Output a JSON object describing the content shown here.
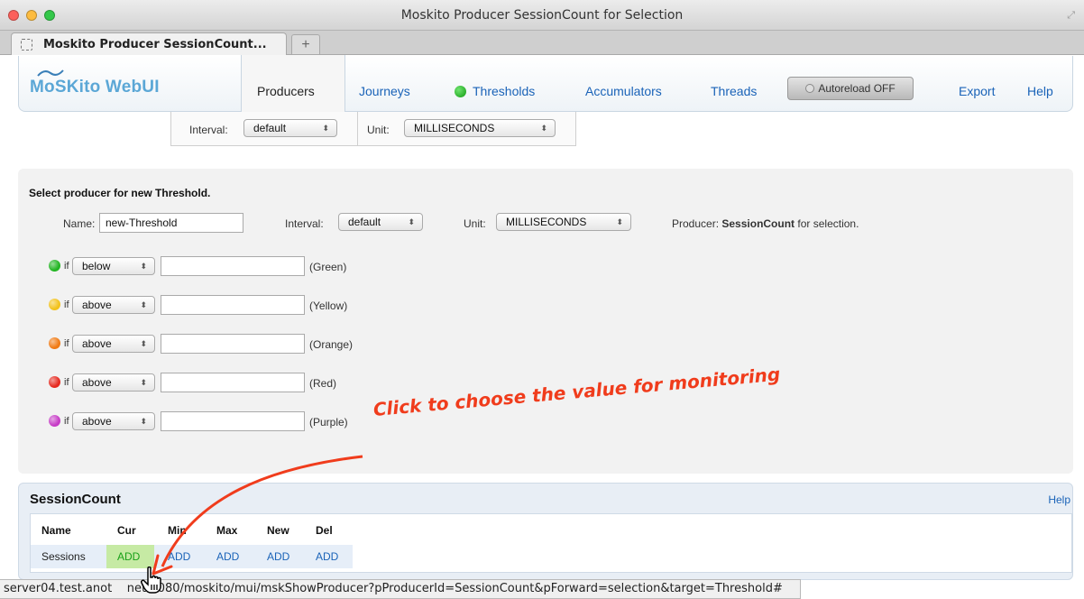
{
  "window": {
    "title": "Moskito Producer SessionCount for Selection",
    "tab_title": "Moskito Producer SessionCount...",
    "new_tab_label": "+"
  },
  "nav": {
    "logo": "MoSKito WebUI",
    "items": [
      "Producers",
      "Journeys",
      "Thresholds",
      "Accumulators",
      "Threads"
    ],
    "autoreload": "Autoreload OFF",
    "export": "Export",
    "help": "Help"
  },
  "filter": {
    "interval_label": "Interval:",
    "interval_value": "default",
    "unit_label": "Unit:",
    "unit_value": "MILLISECONDS"
  },
  "threshold_form": {
    "title": "Select producer for new Threshold.",
    "name_label": "Name:",
    "name_value": "new-Threshold",
    "interval_label": "Interval:",
    "interval_value": "default",
    "unit_label": "Unit:",
    "unit_value": "MILLISECONDS",
    "producer_label": "Producer:",
    "producer_name": "SessionCount",
    "producer_suffix": "for selection.",
    "if_label": "if",
    "rows": [
      {
        "condition": "below",
        "value": "",
        "label": "(Green)",
        "color": "#22b522"
      },
      {
        "condition": "above",
        "value": "",
        "label": "(Yellow)",
        "color": "#f2c21b"
      },
      {
        "condition": "above",
        "value": "",
        "label": "(Orange)",
        "color": "#f07a14"
      },
      {
        "condition": "above",
        "value": "",
        "label": "(Red)",
        "color": "#e62a20"
      },
      {
        "condition": "above",
        "value": "",
        "label": "(Purple)",
        "color": "#c63cc6"
      }
    ]
  },
  "session_count": {
    "title": "SessionCount",
    "help": "Help",
    "columns": [
      "Name",
      "Cur",
      "Min",
      "Max",
      "New",
      "Del"
    ],
    "row": [
      "Sessions",
      "ADD",
      "ADD",
      "ADD",
      "ADD",
      "ADD"
    ]
  },
  "annotation": "Click to choose the value for monitoring",
  "status_url": "server04.test.anot    net:8080/moskito/mui/mskShowProducer?pProducerId=SessionCount&pForward=selection&target=Threshold#",
  "colors": {
    "link": "#1a63b8",
    "annotation": "#f03c1c",
    "cur_highlight": "#c6eaa4"
  }
}
